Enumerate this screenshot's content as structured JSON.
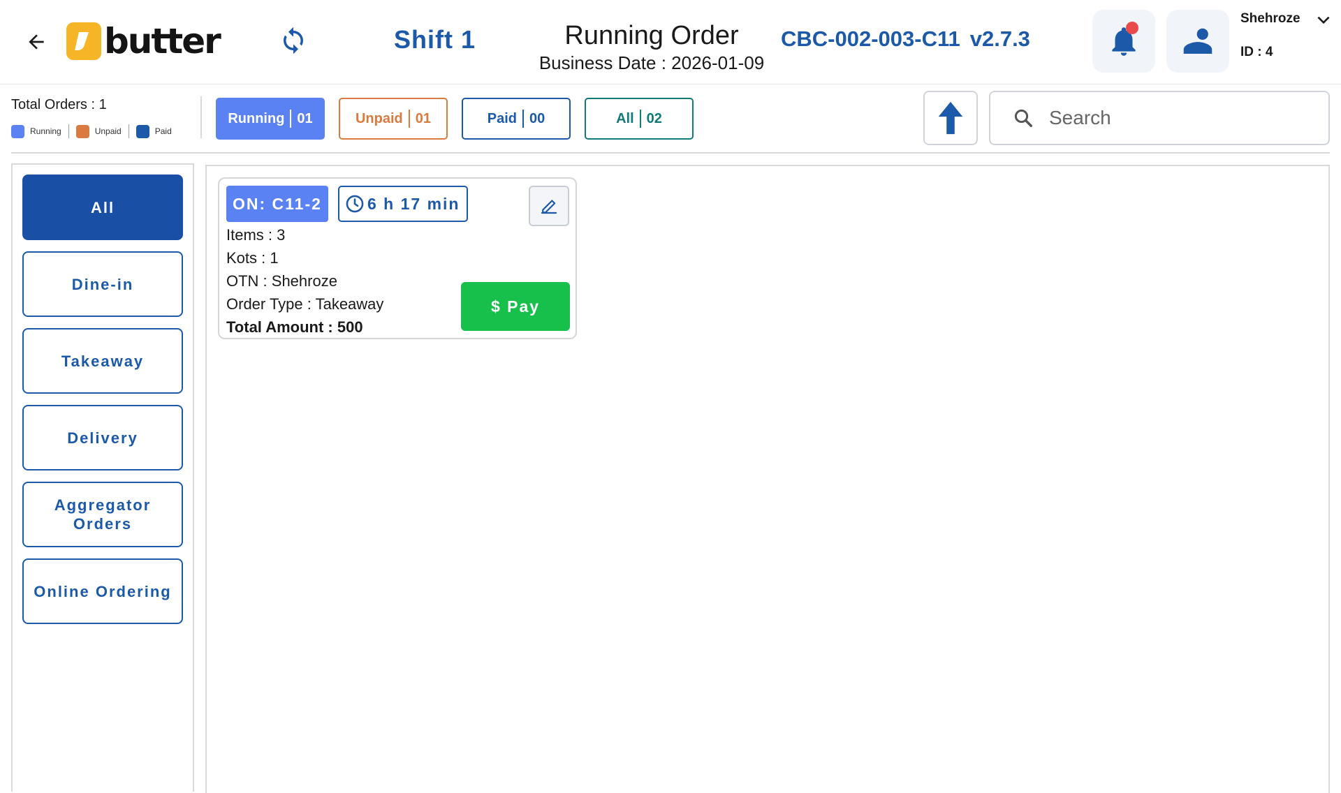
{
  "header": {
    "logo_text": "butter",
    "shift": "Shift 1",
    "title": "Running Order",
    "business_date": "Business Date : 2026-01-09",
    "device_id": "CBC-002-003-C11",
    "version": "v2.7.3",
    "user_name": "Shehroze",
    "user_id": "ID : 4"
  },
  "filters": {
    "total_orders": "Total Orders : 1",
    "legend": [
      {
        "label": "Running",
        "color": "#5a82f2"
      },
      {
        "label": "Unpaid",
        "color": "#d97a3f"
      },
      {
        "label": "Paid",
        "color": "#1c59a8"
      }
    ],
    "tabs": [
      {
        "label": "Running",
        "count": "01"
      },
      {
        "label": "Unpaid",
        "count": "01"
      },
      {
        "label": "Paid",
        "count": "00"
      },
      {
        "label": "All",
        "count": "02"
      }
    ],
    "search_placeholder": "Search"
  },
  "sidebar": {
    "items": [
      {
        "label": "All",
        "active": true
      },
      {
        "label": "Dine-in",
        "active": false
      },
      {
        "label": "Takeaway",
        "active": false
      },
      {
        "label": "Delivery",
        "active": false
      },
      {
        "label": "Aggregator Orders",
        "active": false
      },
      {
        "label": "Online Ordering",
        "active": false
      }
    ]
  },
  "orders": [
    {
      "order_number": "ON: C11-2",
      "elapsed": "6 h 17 min",
      "items": "Items : 3",
      "kots": "Kots : 1",
      "otn": "OTN : Shehroze",
      "order_type": "Order Type : Takeaway",
      "total_amount": "Total Amount : 500",
      "pay_label": "$ Pay"
    }
  ],
  "colors": {
    "brand_blue": "#1c59a8",
    "running": "#5a82f2",
    "unpaid": "#d97a3f",
    "paid": "#1c59a8",
    "all": "#0f7a78",
    "pay_green": "#16c04a",
    "logo_yellow": "#f5b526",
    "notification_red": "#e94a4a"
  },
  "icons": {
    "back": "arrow-left-icon",
    "refresh": "refresh-icon",
    "notification": "bell-icon",
    "profile": "user-icon",
    "dropdown": "chevron-down-icon",
    "scroll_up": "arrow-up-icon",
    "search": "search-icon",
    "timer": "clock-icon",
    "edit": "pencil-icon"
  }
}
